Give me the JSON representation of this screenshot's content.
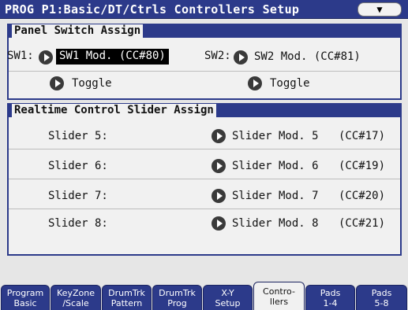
{
  "title_bar": {
    "title": "PROG P1:Basic/DT/Ctrls  Controllers Setup",
    "menu_icon": "chevron-down-icon"
  },
  "panel_switch": {
    "header": "Panel Switch Assign",
    "sw1": {
      "label": "SW1:",
      "assign": "SW1 Mod. (CC#80)",
      "mode": "Toggle"
    },
    "sw2": {
      "label": "SW2:",
      "assign": "SW2 Mod. (CC#81)",
      "mode": "Toggle"
    }
  },
  "realtime_slider": {
    "header": "Realtime Control Slider Assign",
    "rows": [
      {
        "label": "Slider 5:",
        "assign": "Slider Mod. 5",
        "cc": "(CC#17)"
      },
      {
        "label": "Slider 6:",
        "assign": "Slider Mod. 6",
        "cc": "(CC#19)"
      },
      {
        "label": "Slider 7:",
        "assign": "Slider Mod. 7",
        "cc": "(CC#20)"
      },
      {
        "label": "Slider 8:",
        "assign": "Slider Mod. 8",
        "cc": "(CC#21)"
      }
    ]
  },
  "tabs": [
    {
      "line1": "Program",
      "line2": "Basic"
    },
    {
      "line1": "KeyZone",
      "line2": "/Scale"
    },
    {
      "line1": "DrumTrk",
      "line2": "Pattern"
    },
    {
      "line1": "DrumTrk",
      "line2": "Prog"
    },
    {
      "line1": "X-Y",
      "line2": "Setup"
    },
    {
      "line1": "Contro-",
      "line2": "llers"
    },
    {
      "line1": "Pads",
      "line2": "1-4"
    },
    {
      "line1": "Pads",
      "line2": "5-8"
    }
  ],
  "active_tab_index": 5,
  "colors": {
    "accent": "#2c3a8a",
    "background": "#f1f1f1",
    "selected": "#000000"
  }
}
